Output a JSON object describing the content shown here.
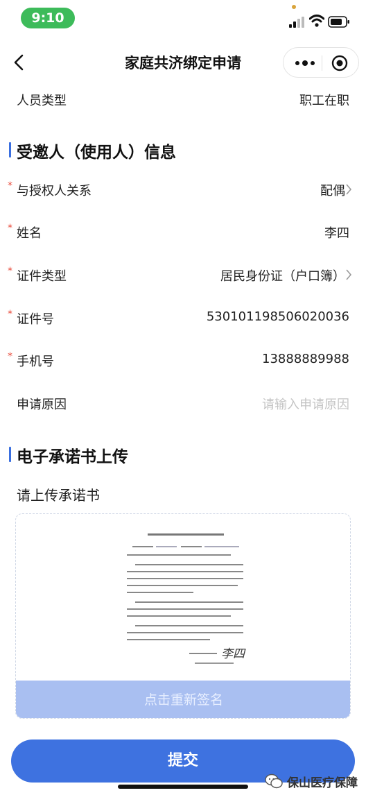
{
  "status_bar": {
    "time": "9:10",
    "time_pill_color": "#3dbb5a"
  },
  "nav": {
    "title": "家庭共济绑定申请",
    "back_icon": "chevron-left-icon",
    "more_icon": "more-dots-icon",
    "close_icon": "mini-program-close-icon"
  },
  "rows": {
    "person_type": {
      "label": "人员类型",
      "value": "职工在职"
    },
    "relation": {
      "label": "与授权人关系",
      "value": "配偶",
      "required": "*"
    },
    "name": {
      "label": "姓名",
      "value": "李四",
      "required": "*"
    },
    "id_type": {
      "label": "证件类型",
      "value": "居民身份证（户口簿）",
      "required": "*"
    },
    "id_number": {
      "label": "证件号",
      "value": "530101198506020036",
      "required": "*"
    },
    "phone": {
      "label": "手机号",
      "value": "13888889988",
      "required": "*"
    },
    "reason": {
      "label": "申请原因",
      "placeholder": "请输入申请原因"
    }
  },
  "sections": {
    "invitee": "受邀人（使用人）信息",
    "upload": "电子承诺书上传"
  },
  "upload": {
    "label": "请上传承诺书",
    "resign_button": "点击重新签名",
    "signature": "李四"
  },
  "submit_button": "提交",
  "watermark": "保山医疗保障",
  "colors": {
    "accent": "#3e72e0",
    "required": "#e84a3a",
    "placeholder": "#c4c4c4",
    "resign_bg": "#a9bff1"
  }
}
